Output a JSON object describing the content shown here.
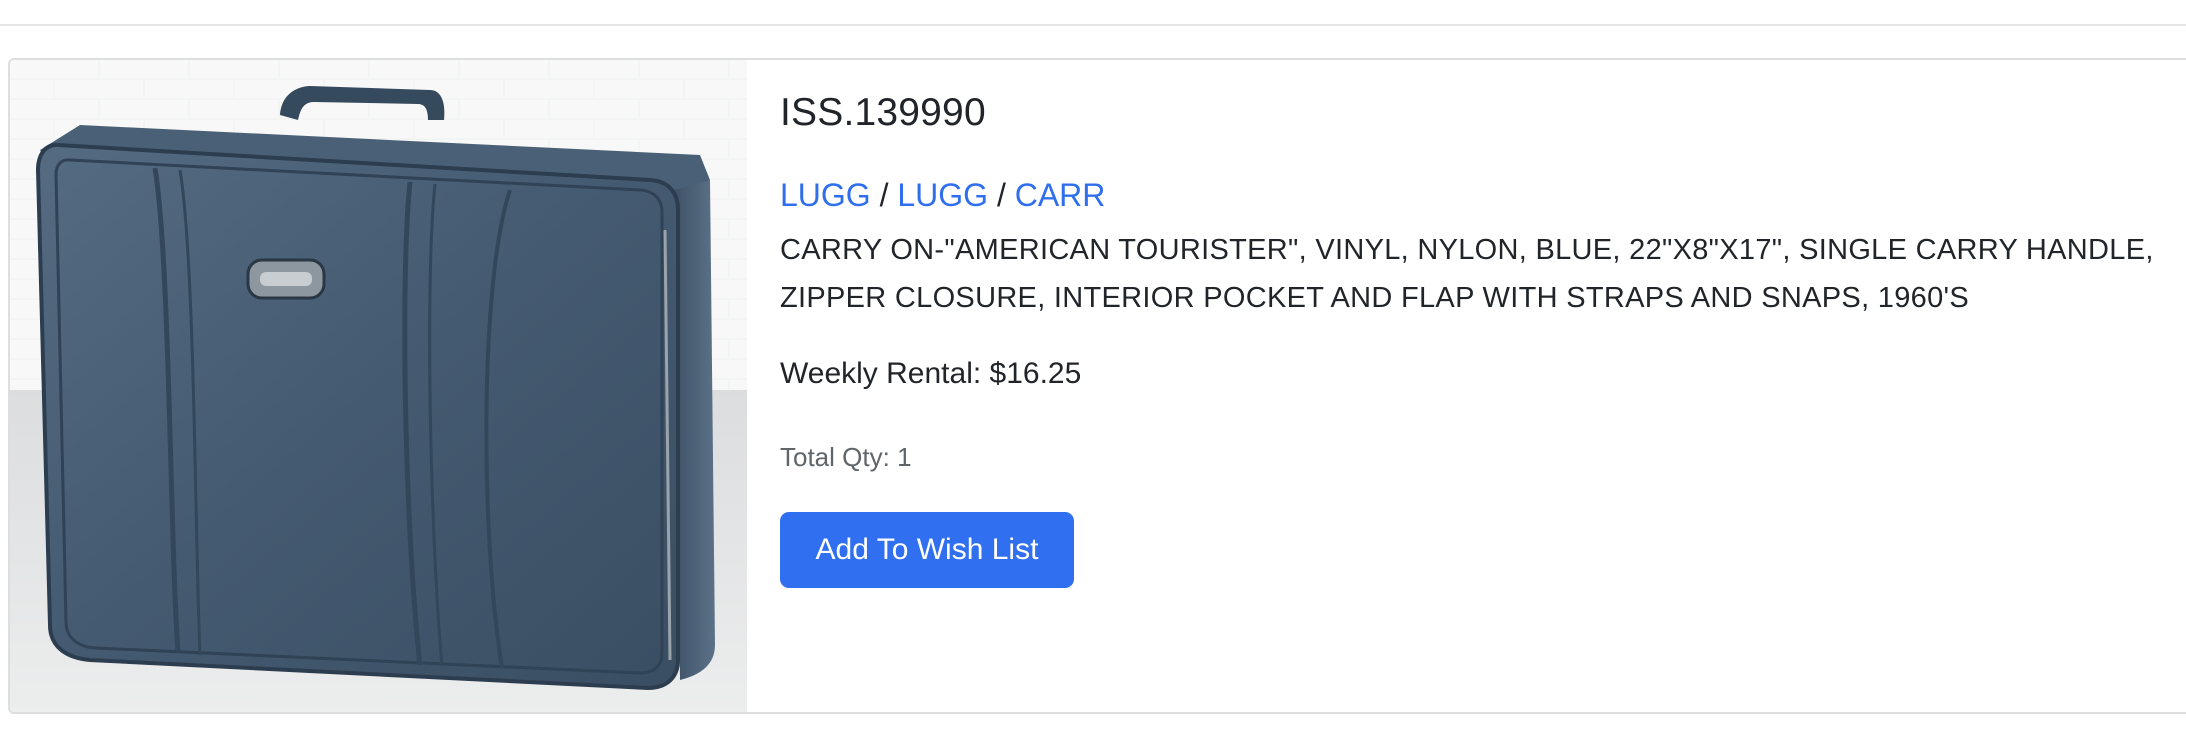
{
  "item": {
    "id": "ISS.139990",
    "categories": [
      "LUGG",
      "LUGG",
      "CARR"
    ],
    "separator": "/",
    "description": "CARRY ON-\"AMERICAN TOURISTER\", VINYL, NYLON, BLUE, 22\"X8\"X17\", SINGLE CARRY HANDLE, ZIPPER CLOSURE, INTERIOR POCKET AND FLAP WITH STRAPS AND SNAPS, 1960'S",
    "weekly_rental_label": "Weekly Rental:",
    "weekly_rental_value": "$16.25",
    "total_qty_label": "Total Qty:",
    "total_qty_value": "1",
    "wish_list_button": "Add To Wish List"
  },
  "colors": {
    "link": "#2f6fed",
    "button": "#2f6ff0",
    "text": "#212529",
    "muted": "#5f6569",
    "border": "#dcdee0"
  }
}
